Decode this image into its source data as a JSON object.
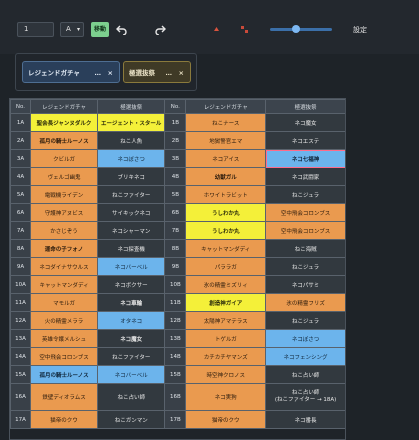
{
  "toolbar": {
    "page_value": "1",
    "select_value": "A",
    "move_label": "移動",
    "settings_label": "設定"
  },
  "chips": [
    {
      "label": "レジェンドガチャ",
      "more": "…",
      "close": "×"
    },
    {
      "label": "極選抜祭",
      "more": "…",
      "close": "×"
    }
  ],
  "table": {
    "headers": [
      "No.",
      "レジェンドガチャ",
      "極選抜祭",
      "No.",
      "レジェンドガチャ",
      "極選抜祭"
    ],
    "rows": [
      {
        "l_no": "1A",
        "l_a": "聖会長ジャンヌダルク",
        "l_b": "エージェント・スタール",
        "r_no": "1B",
        "r_a": "ねこナース",
        "r_b": "ネコ魔女"
      },
      {
        "l_no": "2A",
        "l_a": "孤月の騎士ルーノス",
        "l_b": "ねこ人魚",
        "r_no": "2B",
        "r_a": "地獄警官エマ",
        "r_b": "ネコエステ"
      },
      {
        "l_no": "3A",
        "l_a": "クビルガ",
        "l_b": "ネコぼさつ",
        "r_no": "3B",
        "r_a": "ネコアイス",
        "r_b": "ネコ七福神"
      },
      {
        "l_no": "4A",
        "l_a": "ヴェルゴ幽鬼",
        "l_b": "ブリキネコ",
        "r_no": "4B",
        "r_a": "幼獣ガル",
        "r_b": "ネコ武闘家"
      },
      {
        "l_no": "5A",
        "l_a": "電戦機ライデン",
        "l_b": "ねこファイター",
        "r_no": "5B",
        "r_a": "ホワイトラビット",
        "r_b": "ねこジュラ"
      },
      {
        "l_no": "6A",
        "l_a": "守護神アヌビス",
        "l_b": "サイキックネコ",
        "r_no": "6B",
        "r_a": "うしわか丸",
        "r_b": "空中飛会コロンブス"
      },
      {
        "l_no": "7A",
        "l_a": "かさじぞう",
        "l_b": "ネコシャーマン",
        "r_no": "7B",
        "r_a": "うしわか丸",
        "r_b": "空中飛会コロンブス"
      },
      {
        "l_no": "8A",
        "l_a": "運命の子フォノ",
        "l_b": "ネコ探査機",
        "r_no": "8B",
        "r_a": "キャットマンダディ",
        "r_b": "ねこ海賊"
      },
      {
        "l_no": "9A",
        "l_a": "ネコダイナサウルス",
        "l_b": "ネコバーベル",
        "r_no": "9B",
        "r_a": "パララガ",
        "r_b": "ねこジュラ"
      },
      {
        "l_no": "10A",
        "l_a": "キャットマンダディ",
        "l_b": "ネコボクサー",
        "r_no": "10B",
        "r_a": "氷の精霊ミズリィ",
        "r_b": "ネコパサミ"
      },
      {
        "l_no": "11A",
        "l_a": "マモルガ",
        "l_b": "ネコ車輪",
        "r_no": "11B",
        "r_a": "創造神ガイア",
        "r_b": "氷の精霊フリズ"
      },
      {
        "l_no": "12A",
        "l_a": "火の精霊メララ",
        "l_b": "オタネコ",
        "r_no": "12B",
        "r_a": "太陽神アマテラス",
        "r_b": "ねこジュラ"
      },
      {
        "l_no": "13A",
        "l_a": "英雄令嬢メルシュ",
        "l_b": "ネコ魔女",
        "r_no": "13B",
        "r_a": "トゲルガ",
        "r_b": "ネコぼさつ"
      },
      {
        "l_no": "14A",
        "l_a": "空中飛会コロンブス",
        "l_b": "ねこファイター",
        "r_no": "14B",
        "r_a": "カチカチヤマンズ",
        "r_b": "ネコフェンシング"
      },
      {
        "l_no": "15A",
        "l_a": "孤月の騎士ルーノス",
        "l_b": "ネコバーベル",
        "r_no": "15B",
        "r_a": "時空神クロノス",
        "r_b": "ねこ占い師"
      },
      {
        "l_no": "16A",
        "l_a": "鉄壁ディオラムス",
        "l_b": "ねこ占い師",
        "r_no": "16B",
        "r_a": "ネコ実狗",
        "r_b": "ねこ占い師\n(ねこファイター → 18A)"
      },
      {
        "l_no": "17A",
        "l_a": "猫帝のクウ",
        "l_b": "ねこガンマン",
        "r_no": "17B",
        "r_a": "猫帝のクウ",
        "r_b": "ネコ番長"
      }
    ]
  }
}
